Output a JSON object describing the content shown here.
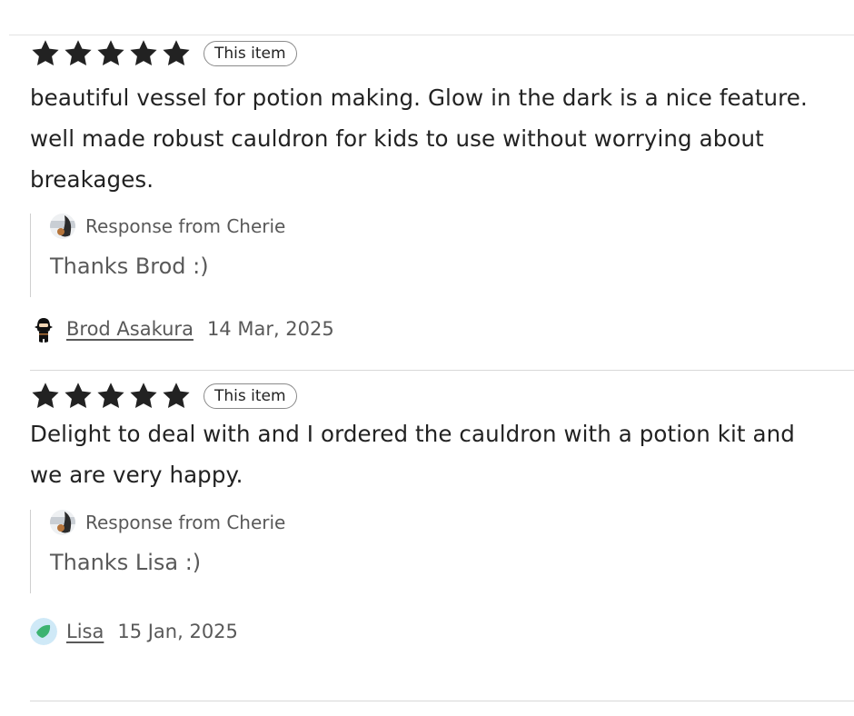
{
  "reviews": [
    {
      "rating": 5,
      "max_rating": 5,
      "badge": "This item",
      "text": "beautiful vessel for potion making. Glow in the dark is a nice feature. well made robust cauldron for kids to use without worrying about breakages.",
      "response": {
        "label": "Response from Cherie",
        "text": "Thanks Brod :)",
        "avatar_icon": "seller-avatar-icon"
      },
      "reviewer": {
        "name": "Brod Asakura",
        "date": "14 Mar, 2025",
        "avatar_icon": "ninja-avatar-icon"
      }
    },
    {
      "rating": 5,
      "max_rating": 5,
      "badge": "This item",
      "text": "Delight to deal with and I ordered the cauldron with a potion kit and we are very happy.",
      "response": {
        "label": "Response from Cherie",
        "text": "Thanks Lisa :)",
        "avatar_icon": "seller-avatar-icon"
      },
      "reviewer": {
        "name": "Lisa",
        "date": "15 Jan, 2025",
        "avatar_icon": "leaf-avatar-icon"
      }
    }
  ],
  "colors": {
    "star": "#222222",
    "text": "#222222",
    "muted_text": "#595959",
    "divider": "#d8d8d8",
    "reviewer_2_avatar_bg": "#cfe9f7",
    "reviewer_2_avatar_fg": "#3cb371"
  }
}
